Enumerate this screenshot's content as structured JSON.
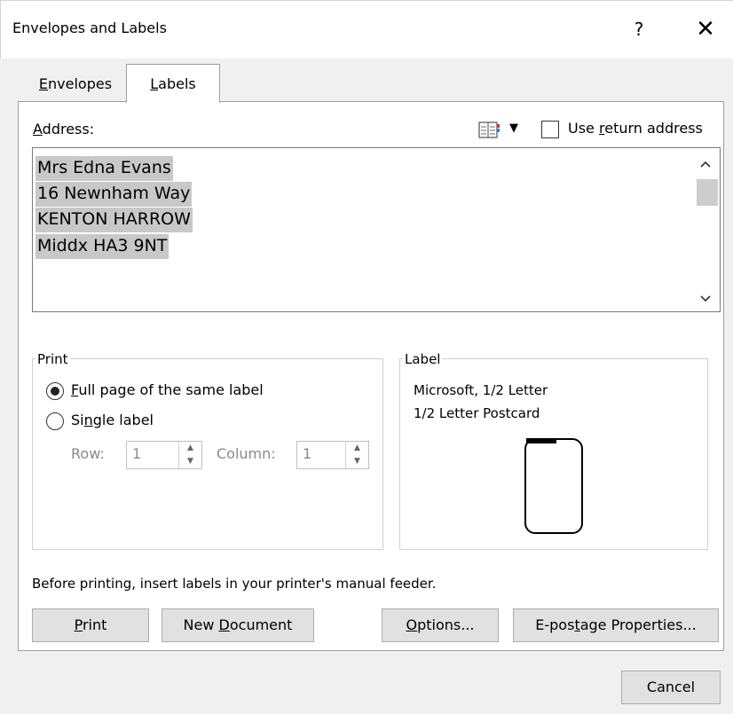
{
  "window": {
    "title": "Envelopes and Labels",
    "help": "?",
    "close": "✕"
  },
  "tabs": [
    {
      "label_u": "E",
      "label_rest": "nvelopes"
    },
    {
      "label_u": "L",
      "label_rest": "abels"
    }
  ],
  "address": {
    "label_u": "A",
    "label_rest": "ddress:",
    "lines": [
      "Mrs Edna Evans",
      "16 Newnham Way",
      "KENTON HARROW",
      "Middx HA3 9NT"
    ],
    "dropdown_arrow": "▼",
    "use_return": {
      "pre": "Use ",
      "u": "r",
      "post": "eturn address",
      "checked": false
    }
  },
  "print_group": {
    "title": "Print",
    "full_page": {
      "u": "F",
      "rest": "ull page of the same label",
      "selected": true
    },
    "single": {
      "pre": "Si",
      "u": "n",
      "post": "gle label",
      "selected": false
    },
    "row_label": "Row:",
    "row_value": "1",
    "column_label": "Column:",
    "column_value": "1"
  },
  "label_group": {
    "title": "Label",
    "vendor": "Microsoft, 1/2 Letter",
    "product": "1/2 Letter Postcard"
  },
  "feeder_note": "Before printing, insert labels in your printer's manual feeder.",
  "buttons": {
    "print": {
      "u": "P",
      "rest": "rint"
    },
    "new_document": {
      "pre": "New ",
      "u": "D",
      "post": "ocument"
    },
    "options": {
      "u": "O",
      "rest": "ptions..."
    },
    "epostage": {
      "pre": "E-pos",
      "u": "t",
      "post": "age Properties..."
    },
    "cancel": "Cancel"
  },
  "icons": {
    "address_book": "address-book-icon",
    "scroll_up": "chevron-up-icon",
    "scroll_down": "chevron-down-icon"
  }
}
